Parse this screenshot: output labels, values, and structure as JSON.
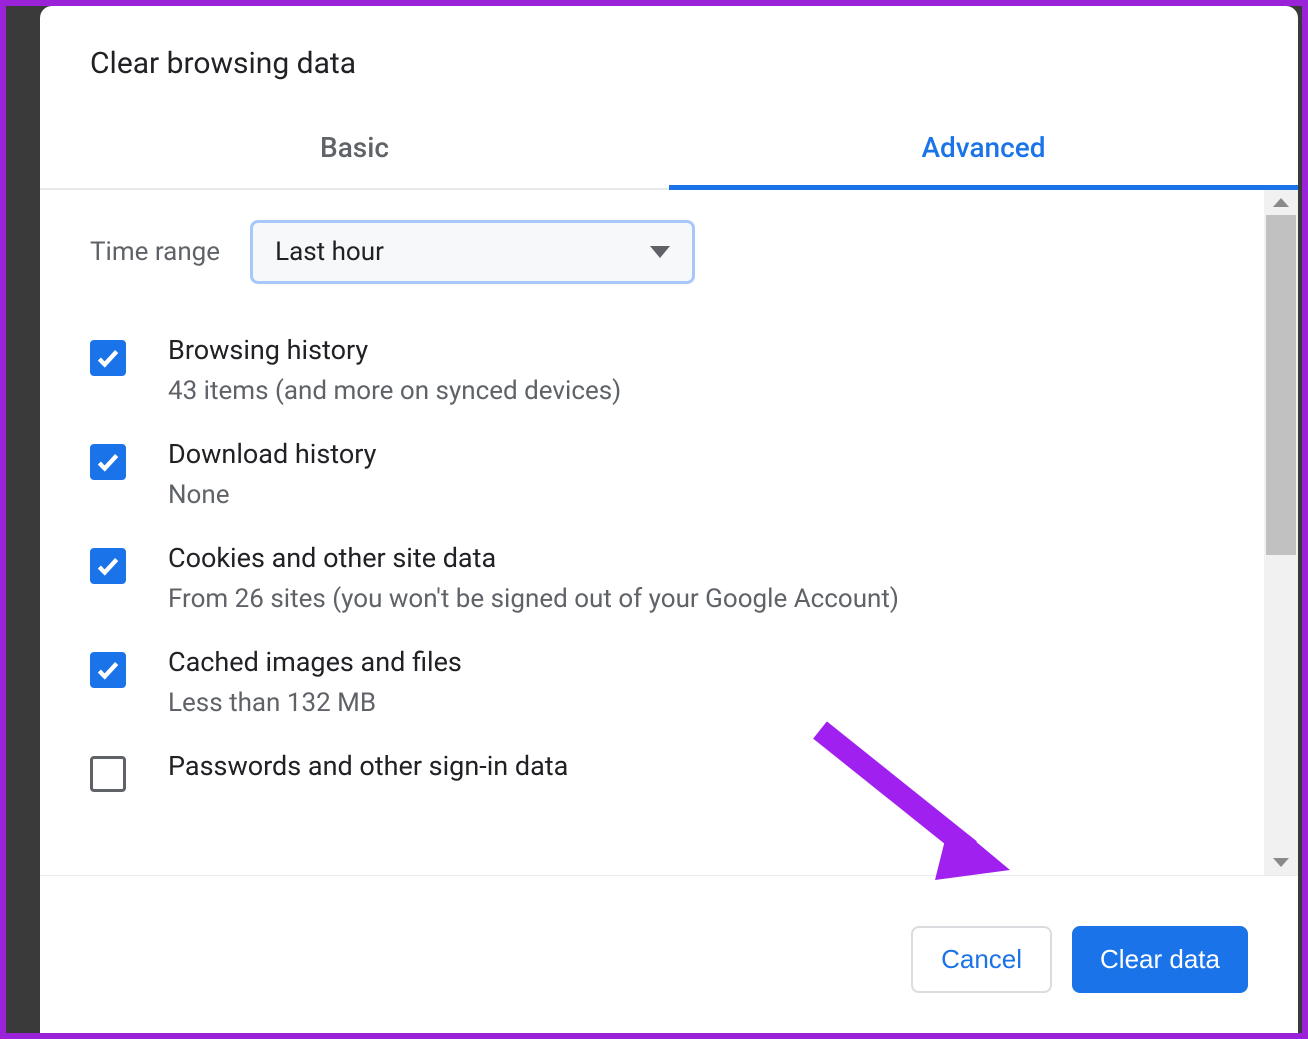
{
  "dialog": {
    "title": "Clear browsing data",
    "tabs": {
      "basic": "Basic",
      "advanced": "Advanced",
      "active": "advanced"
    },
    "timeRange": {
      "label": "Time range",
      "selected": "Last hour"
    },
    "items": [
      {
        "title": "Browsing history",
        "desc": "43 items (and more on synced devices)",
        "checked": true
      },
      {
        "title": "Download history",
        "desc": "None",
        "checked": true
      },
      {
        "title": "Cookies and other site data",
        "desc": "From 26 sites (you won't be signed out of your Google Account)",
        "checked": true
      },
      {
        "title": "Cached images and files",
        "desc": "Less than 132 MB",
        "checked": true
      },
      {
        "title": "Passwords and other sign-in data",
        "desc": "",
        "checked": false
      }
    ],
    "buttons": {
      "cancel": "Cancel",
      "clear": "Clear data"
    }
  }
}
